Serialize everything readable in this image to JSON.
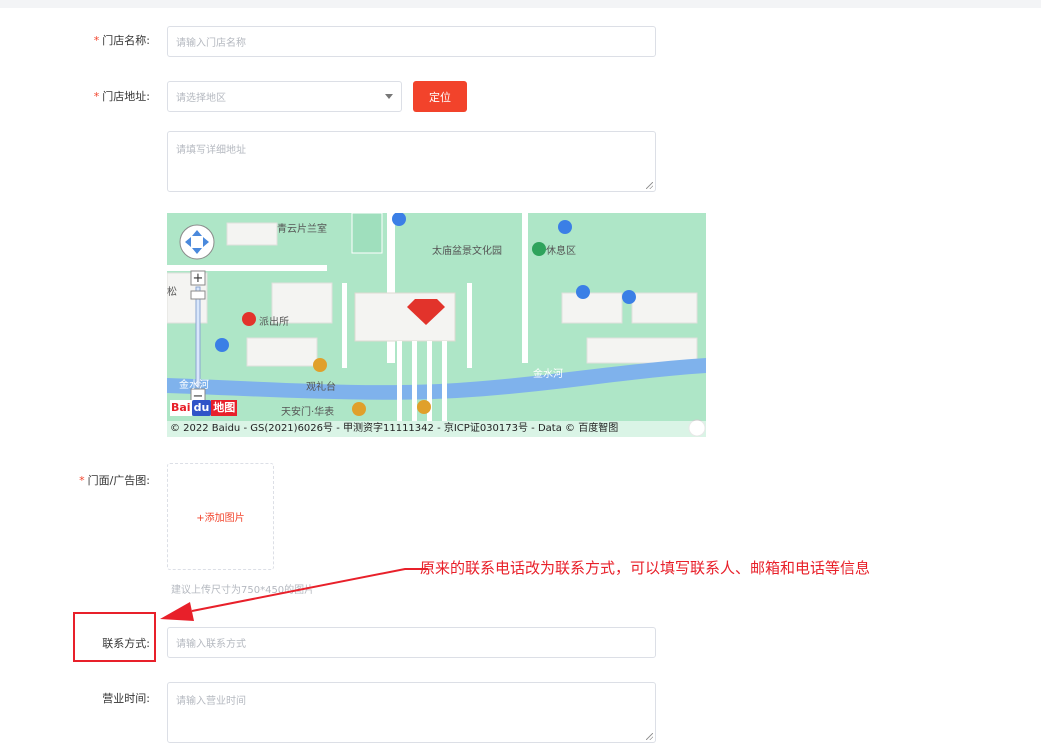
{
  "form": {
    "store_name": {
      "label": "门店名称:",
      "required_mark": "*",
      "placeholder": "请输入门店名称"
    },
    "store_address": {
      "label": "门店地址:",
      "required_mark": "*",
      "region_placeholder": "请选择地区",
      "locate_label": "定位",
      "detail_placeholder": "请填写详细地址"
    },
    "map": {
      "labels": {
        "qingyun": "青云片兰室",
        "taimiao": "太庙盆景文化园",
        "rest_area": "休息区",
        "song": "松",
        "police": "派出所",
        "jinshui_left": "金水河",
        "guanlitai": "观礼台",
        "jinshui_right": "金水河",
        "tiananmen": "天安门·华表"
      },
      "logo": {
        "part1": "Bai",
        "part2": "du",
        "part3": "地图"
      },
      "copyright": "© 2022 Baidu - GS(2021)6026号 - 甲测资字11111342 - 京ICP证030173号 - Data © 百度智图"
    },
    "storefront_image": {
      "label": "门面/广告图:",
      "required_mark": "*",
      "add_label": "+添加图片",
      "hint": "建议上传尺寸为750*450的图片"
    },
    "contact": {
      "label": "联系方式:",
      "placeholder": "请输入联系方式"
    },
    "business_hours": {
      "label": "营业时间:",
      "placeholder": "请输入营业时间"
    }
  },
  "annotation": {
    "text": "原来的联系电话改为联系方式，可以填写联系人、邮箱和电话等信息",
    "color": "#e8202a"
  },
  "colors": {
    "accent": "#f2432b",
    "map_green": "#aee6c7",
    "river": "#7fb2ec"
  }
}
